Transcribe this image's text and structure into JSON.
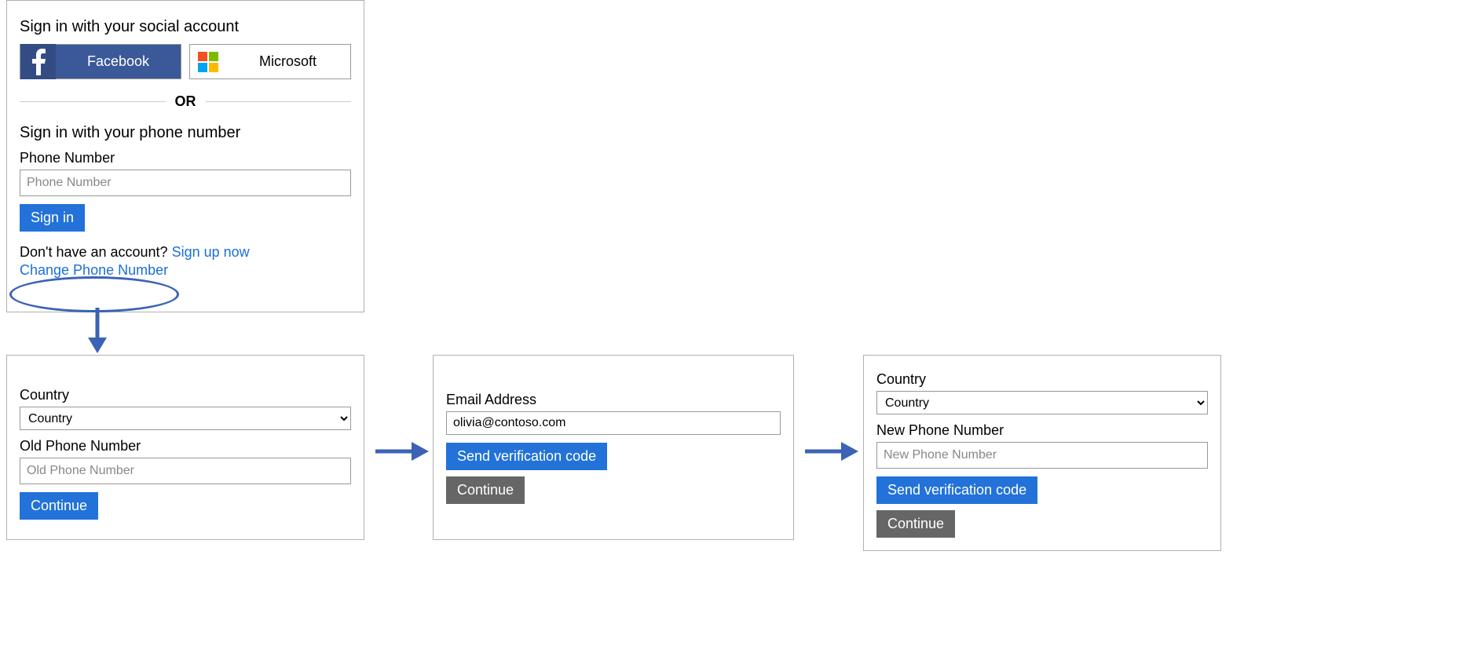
{
  "signin_panel": {
    "social_heading": "Sign in with your social account",
    "facebook_label": "Facebook",
    "microsoft_label": "Microsoft",
    "or_label": "OR",
    "phone_heading": "Sign in with your phone number",
    "phone_label": "Phone Number",
    "phone_placeholder": "Phone Number",
    "signin_button": "Sign in",
    "no_account_text": "Don't have an account? ",
    "signup_link": "Sign up now",
    "change_phone_link": "Change Phone Number"
  },
  "old_phone_panel": {
    "country_label": "Country",
    "country_value": "Country",
    "old_phone_label": "Old Phone Number",
    "old_phone_placeholder": "Old Phone Number",
    "continue_button": "Continue"
  },
  "email_panel": {
    "email_label": "Email Address",
    "email_value": "olivia@contoso.com",
    "send_code_button": "Send verification code",
    "continue_button": "Continue"
  },
  "new_phone_panel": {
    "country_label": "Country",
    "country_value": "Country",
    "new_phone_label": "New Phone Number",
    "new_phone_placeholder": "New Phone Number",
    "send_code_button": "Send verification code",
    "continue_button": "Continue"
  }
}
